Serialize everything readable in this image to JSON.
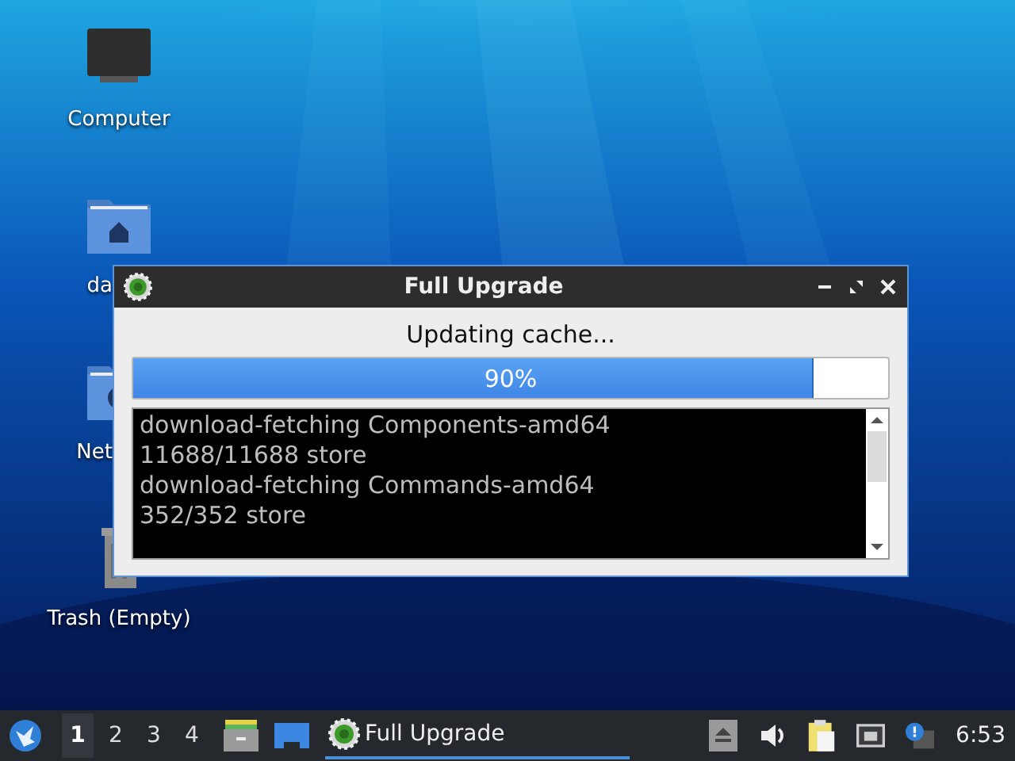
{
  "desktop_icons": [
    {
      "label": "Computer",
      "kind": "computer"
    },
    {
      "label": "da",
      "kind": "home"
    },
    {
      "label": "Net",
      "kind": "network"
    },
    {
      "label": "Trash (Empty)",
      "kind": "trash"
    }
  ],
  "window": {
    "title": "Full Upgrade",
    "status": "Updating cache...",
    "progress": {
      "level": 0.9,
      "text": "90%"
    },
    "log": [
      "download-fetching Components-amd64",
      "11688/11688 store",
      "download-fetching Commands-amd64",
      "352/352 store"
    ]
  },
  "taskbar": {
    "workspaces": [
      {
        "label": "1",
        "selected": true
      },
      {
        "label": "2",
        "selected": false
      },
      {
        "label": "3",
        "selected": false
      },
      {
        "label": "4",
        "selected": false
      }
    ],
    "tasks": [
      {
        "label": "Full Upgrade",
        "selected": true
      }
    ],
    "clock": "6:53"
  }
}
